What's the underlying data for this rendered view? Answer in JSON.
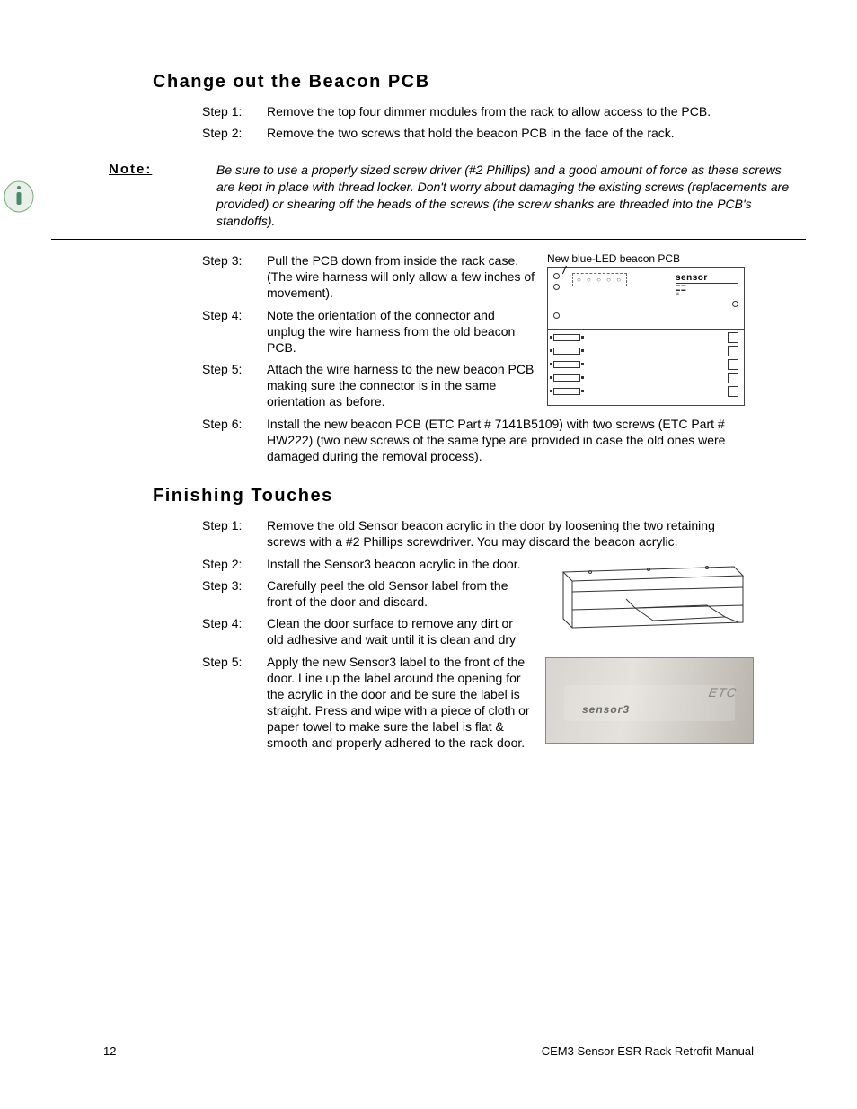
{
  "section1": {
    "heading": "Change out the Beacon PCB",
    "steps_a": [
      {
        "label": "Step 1:",
        "text": "Remove the top four dimmer modules from the rack to allow access to the PCB."
      },
      {
        "label": "Step 2:",
        "text": "Remove the two screws that hold the beacon PCB in the face of the rack."
      }
    ],
    "note_label": "Note:",
    "note_text": "Be sure to use a properly sized screw driver (#2 Phillips) and a good amount of force as these screws are kept in place with thread locker. Don't worry about damaging the existing screws (replacements are provided) or shearing off the heads of the screws (the screw shanks are threaded into the PCB's standoffs).",
    "diagram_label": "New blue-LED beacon PCB",
    "sensor_label_text": "sensor",
    "steps_b": [
      {
        "label": "Step 3:",
        "text": "Pull the PCB down from inside the rack case. (The wire harness will only allow a few inches of movement)."
      },
      {
        "label": "Step 4:",
        "text": "Note the orientation of the connector and unplug the wire harness from the old beacon PCB."
      },
      {
        "label": "Step 5:",
        "text": "Attach the wire harness to the new beacon PCB making sure the connector is in the same orientation as before."
      },
      {
        "label": "Step 6:",
        "text": "Install the new beacon PCB (ETC Part # 7141B5109) with two screws (ETC Part # HW222) (two new screws of the same type are provided in case the old ones were damaged during the removal process)."
      }
    ]
  },
  "section2": {
    "heading": "Finishing Touches",
    "steps": [
      {
        "label": "Step 1:",
        "text": "Remove the old Sensor beacon acrylic in the door by loosening the two retaining screws with a #2 Phillips screwdriver. You may discard the beacon acrylic."
      },
      {
        "label": "Step 2:",
        "text": "Install the Sensor3 beacon acrylic in the door."
      },
      {
        "label": "Step 3:",
        "text": "Carefully peel the old Sensor label from the front of the door and discard."
      },
      {
        "label": "Step 4:",
        "text": "Clean the door surface to remove any dirt or old adhesive and wait until it is clean and dry"
      },
      {
        "label": "Step 5:",
        "text": "Apply the new Sensor3 label to the front of the door. Line up the label around the opening for the acrylic in the door and be sure the label is straight. Press and wipe with a piece of cloth or paper towel to make sure the label is flat & smooth and properly adhered to the rack door."
      }
    ],
    "photo_label": "sensor3",
    "photo_brand": "ETC"
  },
  "footer": {
    "page": "12",
    "title": "CEM3 Sensor ESR Rack Retrofit Manual"
  }
}
